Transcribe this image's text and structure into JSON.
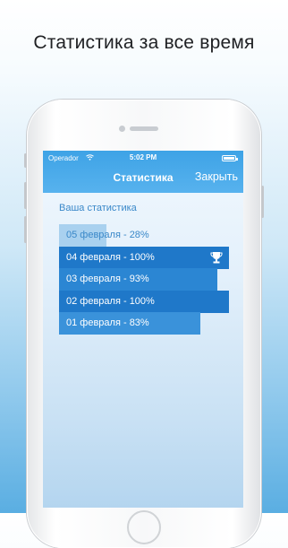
{
  "headline": "Статистика за все время",
  "status_bar": {
    "carrier": "Operador",
    "time": "5:02 PM"
  },
  "navbar": {
    "title": "Статистика",
    "close_label": "Закрыть"
  },
  "section_label": "Ваша статистика",
  "stats": [
    {
      "label": "05 февраля - 28%",
      "value": 28,
      "color": "#ffffff",
      "fill": "#a9d1ef",
      "text_color": "#3a88c9",
      "trophy": false
    },
    {
      "label": "04 февраля - 100%",
      "value": 100,
      "fill": "#1f78c9",
      "text_color": "#ffffff",
      "trophy": true
    },
    {
      "label": "03 февраля - 93%",
      "value": 93,
      "fill": "#2b86d3",
      "text_color": "#ffffff",
      "trophy": false
    },
    {
      "label": "02 февраля - 100%",
      "value": 100,
      "fill": "#1f78c9",
      "text_color": "#ffffff",
      "trophy": false
    },
    {
      "label": "01 февраля - 83%",
      "value": 83,
      "fill": "#3a92da",
      "text_color": "#ffffff",
      "trophy": false
    }
  ],
  "icons": {
    "trophy": "trophy-icon",
    "wifi": "wifi-icon",
    "battery": "battery-icon"
  }
}
